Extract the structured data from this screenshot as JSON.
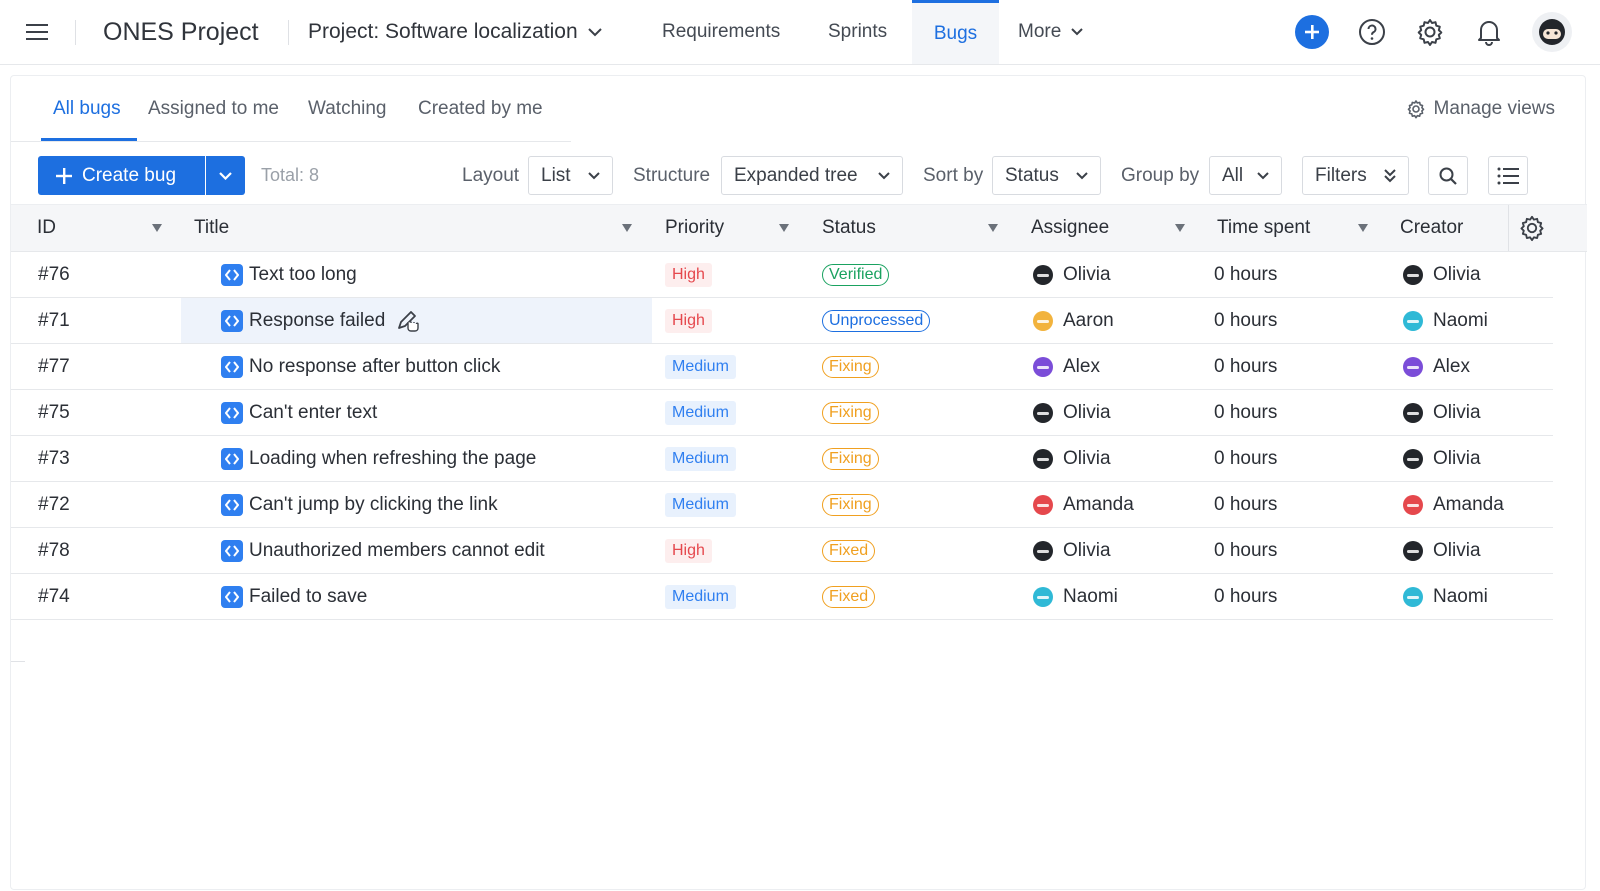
{
  "topbar": {
    "app_title": "ONES Project",
    "project_label": "Project: Software localization",
    "nav": [
      {
        "label": "Requirements"
      },
      {
        "label": "Sprints"
      },
      {
        "label": "Bugs",
        "active": true
      },
      {
        "label": "More"
      }
    ]
  },
  "tabs": [
    {
      "label": "All bugs",
      "active": true
    },
    {
      "label": "Assigned to me"
    },
    {
      "label": "Watching"
    },
    {
      "label": "Created by me"
    }
  ],
  "manage_views_label": "Manage views",
  "toolbar": {
    "create_label": "Create bug",
    "total_label": "Total: 8",
    "layout_label": "Layout",
    "layout_value": "List",
    "structure_label": "Structure",
    "structure_value": "Expanded tree",
    "sort_label": "Sort by",
    "sort_value": "Status",
    "group_label": "Group by",
    "group_value": "All",
    "filters_label": "Filters"
  },
  "columns": [
    "ID",
    "Title",
    "Priority",
    "Status",
    "Assignee",
    "Time spent",
    "Creator"
  ],
  "colors": {
    "accent": "#1d6fe0",
    "high": "#e5484d",
    "medium": "#2f7ff0",
    "verified": "#1aa260",
    "fixing": "#f0a020"
  },
  "avatar_colors": {
    "Olivia": "#23262b",
    "Aaron": "#f2b33d",
    "Naomi": "#2fb9d6",
    "Alex": "#7b4dd8",
    "Amanda": "#e5484d"
  },
  "rows": [
    {
      "id": "#76",
      "title": "Text too long",
      "priority": "High",
      "status": "Verified",
      "assignee": "Olivia",
      "time": "0 hours",
      "creator": "Olivia"
    },
    {
      "id": "#71",
      "title": "Response failed",
      "priority": "High",
      "status": "Unprocessed",
      "assignee": "Aaron",
      "time": "0 hours",
      "creator": "Naomi",
      "hovered": true
    },
    {
      "id": "#77",
      "title": "No response after button click",
      "priority": "Medium",
      "status": "Fixing",
      "assignee": "Alex",
      "time": "0 hours",
      "creator": "Alex"
    },
    {
      "id": "#75",
      "title": "Can't enter text",
      "priority": "Medium",
      "status": "Fixing",
      "assignee": "Olivia",
      "time": "0 hours",
      "creator": "Olivia"
    },
    {
      "id": "#73",
      "title": "Loading when refreshing the page",
      "priority": "Medium",
      "status": "Fixing",
      "assignee": "Olivia",
      "time": "0 hours",
      "creator": "Olivia"
    },
    {
      "id": "#72",
      "title": "Can't jump by clicking the link",
      "priority": "Medium",
      "status": "Fixing",
      "assignee": "Amanda",
      "time": "0 hours",
      "creator": "Amanda"
    },
    {
      "id": "#78",
      "title": "Unauthorized members cannot edit",
      "priority": "High",
      "status": "Fixed",
      "assignee": "Olivia",
      "time": "0 hours",
      "creator": "Olivia"
    },
    {
      "id": "#74",
      "title": "Failed to save",
      "priority": "Medium",
      "status": "Fixed",
      "assignee": "Naomi",
      "time": "0 hours",
      "creator": "Naomi"
    }
  ]
}
